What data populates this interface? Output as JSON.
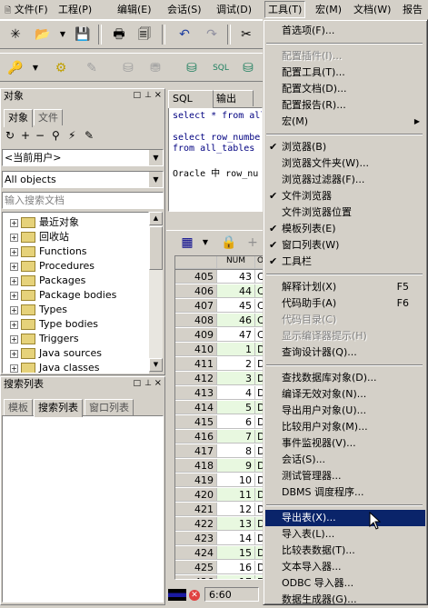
{
  "menubar": [
    {
      "label": "文件(F)"
    },
    {
      "label": "工程(P)"
    },
    {
      "label": "编辑(E)"
    },
    {
      "label": "会话(S)"
    },
    {
      "label": "调试(D)"
    },
    {
      "label": "工具(T)"
    },
    {
      "label": "宏(M)"
    },
    {
      "label": "文档(W)"
    },
    {
      "label": "报告"
    }
  ],
  "left_panel": {
    "title": "对象",
    "tabs": [
      "对象",
      "文件"
    ],
    "owner_combo": "<当前用户>",
    "type_combo": "All objects",
    "search_placeholder": "输入搜索文档",
    "tree": [
      "最近对象",
      "回收站",
      "Functions",
      "Procedures",
      "Packages",
      "Package bodies",
      "Types",
      "Type bodies",
      "Triggers",
      "Java sources",
      "Java classes"
    ]
  },
  "search_panel": {
    "title": "搜索列表",
    "tabs": [
      "模板",
      "搜索列表",
      "窗口列表"
    ]
  },
  "editor": {
    "tabs": [
      "SQL",
      "输出"
    ],
    "lines": [
      "select * from all",
      "",
      "select row_number",
      "from all_tables",
      "",
      "Oracle 中 row_nu"
    ]
  },
  "grid": {
    "header_num": "NUM",
    "header_o": "O",
    "rows": [
      {
        "rn": "405",
        "num": "43",
        "o": "C"
      },
      {
        "rn": "406",
        "num": "44",
        "o": "C"
      },
      {
        "rn": "407",
        "num": "45",
        "o": "C"
      },
      {
        "rn": "408",
        "num": "46",
        "o": "C"
      },
      {
        "rn": "409",
        "num": "47",
        "o": "C"
      },
      {
        "rn": "410",
        "num": "1",
        "o": "D"
      },
      {
        "rn": "411",
        "num": "2",
        "o": "D"
      },
      {
        "rn": "412",
        "num": "3",
        "o": "D"
      },
      {
        "rn": "413",
        "num": "4",
        "o": "D"
      },
      {
        "rn": "414",
        "num": "5",
        "o": "D"
      },
      {
        "rn": "415",
        "num": "6",
        "o": "D"
      },
      {
        "rn": "416",
        "num": "7",
        "o": "D"
      },
      {
        "rn": "417",
        "num": "8",
        "o": "D"
      },
      {
        "rn": "418",
        "num": "9",
        "o": "D"
      },
      {
        "rn": "419",
        "num": "10",
        "o": "D"
      },
      {
        "rn": "420",
        "num": "11",
        "o": "D"
      },
      {
        "rn": "421",
        "num": "12",
        "o": "D"
      },
      {
        "rn": "422",
        "num": "13",
        "o": "D"
      },
      {
        "rn": "423",
        "num": "14",
        "o": "D"
      },
      {
        "rn": "424",
        "num": "15",
        "o": "D"
      },
      {
        "rn": "425",
        "num": "16",
        "o": "D"
      },
      {
        "rn": "426",
        "num": "17",
        "o": "D"
      },
      {
        "rn": "427",
        "num": "18",
        "o": "D"
      },
      {
        "rn": "428",
        "num": "19",
        "o": "D"
      },
      {
        "rn": "429",
        "num": "20",
        "o": "D"
      }
    ]
  },
  "status": {
    "position": "6:60"
  },
  "tools_menu": {
    "items": [
      {
        "label": "首选项(F)...",
        "type": "item"
      },
      {
        "type": "sep"
      },
      {
        "label": "配置插件(I)...",
        "type": "item",
        "disabled": true
      },
      {
        "label": "配置工具(T)...",
        "type": "item"
      },
      {
        "label": "配置文档(D)...",
        "type": "item"
      },
      {
        "label": "配置报告(R)...",
        "type": "item"
      },
      {
        "label": "宏(M)",
        "type": "item",
        "submenu": true
      },
      {
        "type": "sep"
      },
      {
        "label": "浏览器(B)",
        "type": "item",
        "checked": true
      },
      {
        "label": "浏览器文件夹(W)...",
        "type": "item"
      },
      {
        "label": "浏览器过滤器(F)...",
        "type": "item"
      },
      {
        "label": "文件浏览器",
        "type": "item",
        "checked": true
      },
      {
        "label": "文件浏览器位置",
        "type": "item"
      },
      {
        "label": "模板列表(E)",
        "type": "item",
        "checked": true
      },
      {
        "label": "窗口列表(W)",
        "type": "item",
        "checked": true
      },
      {
        "label": "工具栏",
        "type": "item",
        "checked": true
      },
      {
        "type": "sep"
      },
      {
        "label": "解释计划(X)",
        "type": "item",
        "shortcut": "F5"
      },
      {
        "label": "代码助手(A)",
        "type": "item",
        "shortcut": "F6"
      },
      {
        "label": "代码目录(C)",
        "type": "item",
        "disabled": true
      },
      {
        "label": "显示编译器提示(H)",
        "type": "item",
        "disabled": true
      },
      {
        "label": "查询设计器(Q)...",
        "type": "item"
      },
      {
        "type": "sep"
      },
      {
        "label": "查找数据库对象(D)...",
        "type": "item"
      },
      {
        "label": "编译无效对象(N)...",
        "type": "item"
      },
      {
        "label": "导出用户对象(U)...",
        "type": "item"
      },
      {
        "label": "比较用户对象(M)...",
        "type": "item"
      },
      {
        "label": "事件监视器(V)...",
        "type": "item"
      },
      {
        "label": "会话(S)...",
        "type": "item"
      },
      {
        "label": "测试管理器...",
        "type": "item"
      },
      {
        "label": "DBMS 调度程序...",
        "type": "item"
      },
      {
        "type": "sep"
      },
      {
        "label": "导出表(X)...",
        "type": "item",
        "highlighted": true
      },
      {
        "label": "导入表(L)...",
        "type": "item"
      },
      {
        "label": "比较表数据(T)...",
        "type": "item"
      },
      {
        "label": "文本导入器...",
        "type": "item"
      },
      {
        "label": "ODBC 导入器...",
        "type": "item"
      },
      {
        "label": "数据生成器(G)...",
        "type": "item"
      }
    ]
  }
}
